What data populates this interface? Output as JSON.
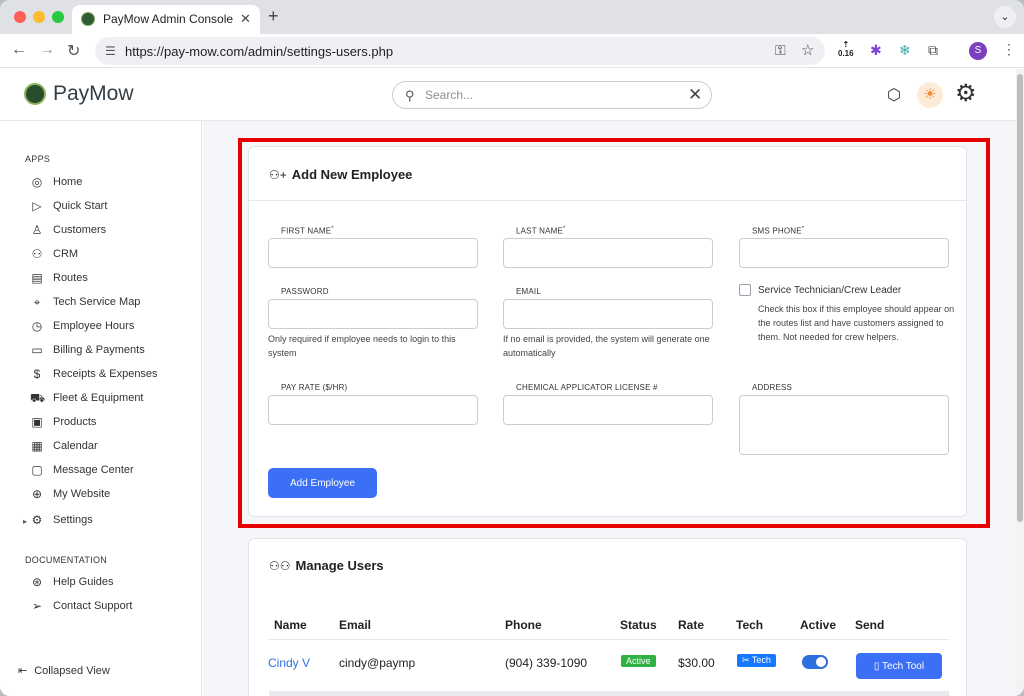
{
  "browser": {
    "tab_title": "PayMow Admin Console",
    "url": "https://pay-mow.com/admin/settings-users.php",
    "ext_badge": "0.16",
    "profile_initial": "S"
  },
  "header": {
    "logo_text": "PayMow",
    "search_placeholder": "Search..."
  },
  "sidebar": {
    "apps_title": "APPS",
    "items": [
      {
        "label": "Home",
        "icon": "compass-icon"
      },
      {
        "label": "Quick Start",
        "icon": "play-circle-icon"
      },
      {
        "label": "Customers",
        "icon": "person-icon"
      },
      {
        "label": "CRM",
        "icon": "people-icon"
      },
      {
        "label": "Routes",
        "icon": "map-icon"
      },
      {
        "label": "Tech Service Map",
        "icon": "location-pin-icon"
      },
      {
        "label": "Employee Hours",
        "icon": "clock-icon"
      },
      {
        "label": "Billing & Payments",
        "icon": "receipt-icon"
      },
      {
        "label": "Receipts & Expenses",
        "icon": "dollar-icon"
      },
      {
        "label": "Fleet & Equipment",
        "icon": "truck-icon"
      },
      {
        "label": "Products",
        "icon": "box-icon"
      },
      {
        "label": "Calendar",
        "icon": "calendar-icon"
      },
      {
        "label": "Message Center",
        "icon": "message-icon"
      },
      {
        "label": "My Website",
        "icon": "globe-icon"
      },
      {
        "label": "Settings",
        "icon": "gear-icon"
      }
    ],
    "docs_title": "DOCUMENTATION",
    "docs": [
      {
        "label": "Help Guides",
        "icon": "lifebuoy-icon"
      },
      {
        "label": "Contact Support",
        "icon": "send-icon"
      }
    ],
    "collapsed_label": "Collapsed View"
  },
  "add_employee": {
    "title": "Add New Employee",
    "first_name_label": "FIRST NAME",
    "last_name_label": "LAST NAME",
    "sms_phone_label": "SMS PHONE",
    "required_mark": "*",
    "password_label": "PASSWORD",
    "password_help": "Only required if employee needs to login to this system",
    "email_label": "EMAIL",
    "email_help": "If no email is provided, the system will generate one automatically",
    "service_tech_label": "Service Technician/Crew Leader",
    "service_tech_help": "Check this box if this employee should appear on the routes list and have customers assigned to them. Not needed for crew helpers.",
    "pay_rate_label": "PAY RATE ($/HR)",
    "license_label": "CHEMICAL APPLICATOR LICENSE #",
    "address_label": "ADDRESS",
    "button_label": "Add Employee"
  },
  "manage_users": {
    "title": "Manage Users",
    "columns": [
      "Name",
      "Email",
      "Phone",
      "Status",
      "Rate",
      "Tech",
      "Active",
      "Send"
    ],
    "rows": [
      {
        "name": "Cindy V",
        "email": "cindy@paymp",
        "phone": "(904) 339-1090",
        "status": "Active",
        "rate": "$30.00",
        "tech": "Tech",
        "send": "Tech Tool"
      }
    ]
  }
}
